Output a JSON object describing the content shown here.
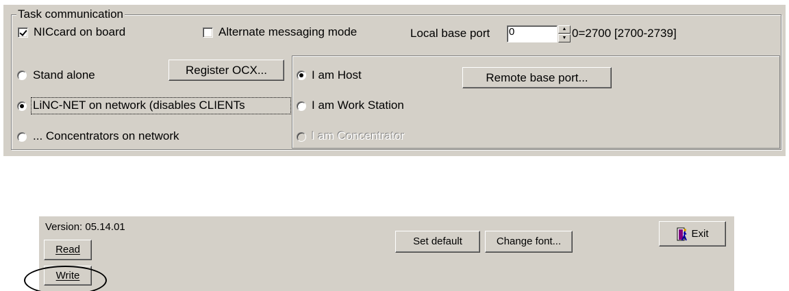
{
  "task_comm": {
    "title": "Task communication",
    "nic_card_label": "NICcard on board",
    "nic_card_checked": true,
    "alt_msg_label": "Alternate messaging mode",
    "alt_msg_checked": false,
    "local_base_port_label": "Local base port",
    "local_base_port_value": "0",
    "port_hint": "0=2700 [2700-2739]",
    "mode_options": [
      {
        "label": "Stand alone",
        "selected": false
      },
      {
        "label": "LiNC-NET on network (disables CLIENTs",
        "selected": true
      },
      {
        "label": "... Concentrators on network",
        "selected": false
      }
    ],
    "register_ocx_label": "Register OCX...",
    "role_options": [
      {
        "label": "I am Host",
        "selected": true,
        "enabled": true
      },
      {
        "label": "I am Work Station",
        "selected": false,
        "enabled": true
      },
      {
        "label": "I am Concentrator",
        "selected": false,
        "enabled": false
      }
    ],
    "remote_base_port_label": "Remote base port..."
  },
  "bottom_bar": {
    "version_text": "Version: 05.14.01",
    "read_label": "Read",
    "write_label": "Write",
    "set_default_label": "Set default",
    "change_font_label": "Change font...",
    "exit_label": "Exit",
    "exit_icon": "exit-door-icon"
  },
  "colors": {
    "dialog_bg": "#d4d0c8",
    "annotation": "#000000"
  }
}
